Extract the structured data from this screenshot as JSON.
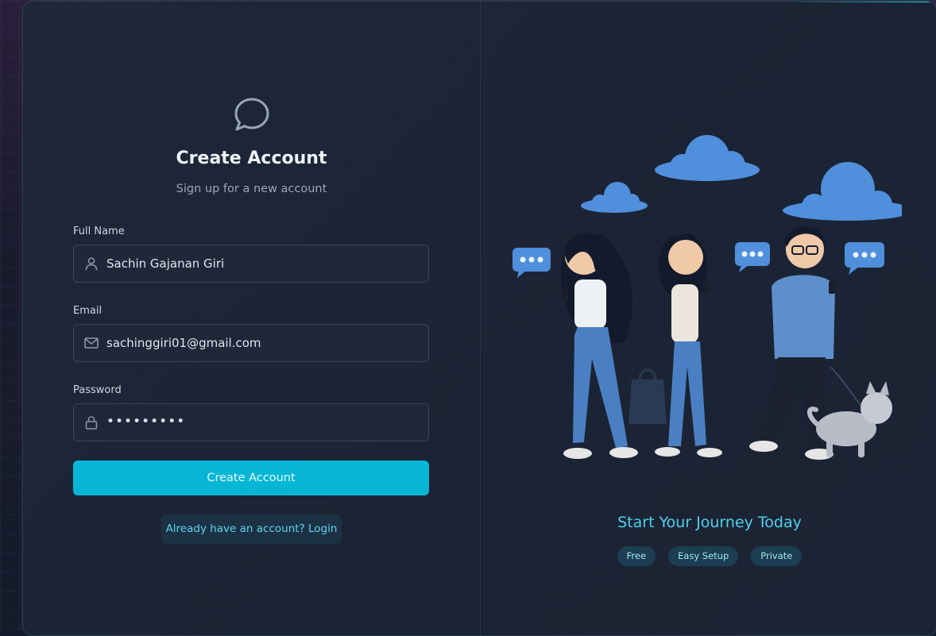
{
  "form": {
    "title": "Create Account",
    "subtitle": "Sign up for a new account",
    "fields": [
      {
        "label": "Full Name",
        "value": "Sachin Gajanan Giri",
        "icon": "user-icon"
      },
      {
        "label": "Email",
        "value": "sachinggiri01@gmail.com",
        "icon": "mail-icon"
      },
      {
        "label": "Password",
        "value": "•••••••••",
        "icon": "lock-icon"
      }
    ],
    "submit_label": "Create Account",
    "login_link": "Already have an account? Login"
  },
  "promo": {
    "tagline": "Start Your Journey Today",
    "chips": [
      "Free",
      "Easy Setup",
      "Private"
    ]
  },
  "colors": {
    "accent": "#06b6d4",
    "background": "#1e2738",
    "field_bg": "#1f2838"
  },
  "icons": {
    "logo": "chat-bubble-icon"
  }
}
